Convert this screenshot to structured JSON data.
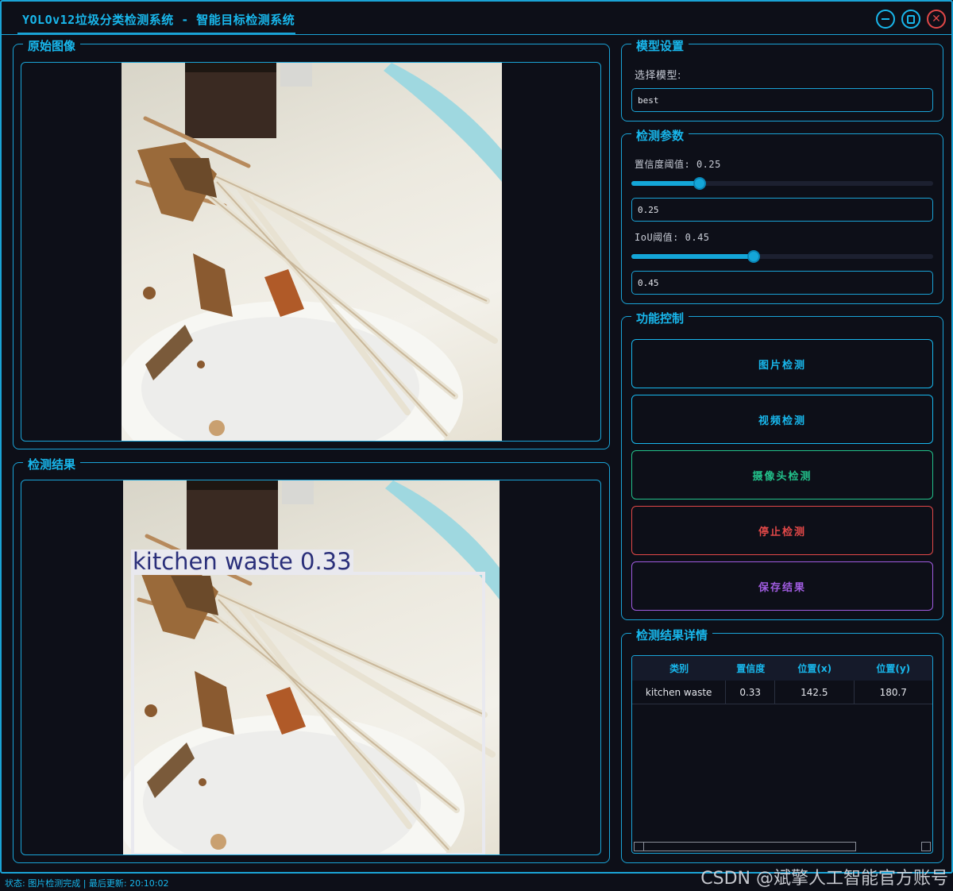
{
  "window": {
    "title": "YOLOv12垃圾分类检测系统 - 智能目标检测系统",
    "controls": [
      "minimize-icon",
      "maximize-icon",
      "close-icon"
    ]
  },
  "original_panel": {
    "title": "原始图像"
  },
  "result_panel": {
    "title": "检测结果",
    "detection_label": "kitchen waste 0.33"
  },
  "model_settings": {
    "title": "模型设置",
    "select_label": "选择模型:",
    "selected_model": "best"
  },
  "detection_params": {
    "title": "检测参数",
    "confidence_label": "置信度阈值: 0.25",
    "confidence_value": "0.25",
    "confidence_fraction": 0.25,
    "iou_label": "IoU阈值: 0.45",
    "iou_value": "0.45",
    "iou_fraction": 0.45
  },
  "function_control": {
    "title": "功能控制",
    "buttons": [
      {
        "label": "图片检测",
        "color": "#18b7ec"
      },
      {
        "label": "视频检测",
        "color": "#18b7ec"
      },
      {
        "label": "摄像头检测",
        "color": "#22c08a"
      },
      {
        "label": "停止检测",
        "color": "#e24848"
      },
      {
        "label": "保存结果",
        "color": "#a05ce0"
      }
    ]
  },
  "results_detail": {
    "title": "检测结果详情",
    "columns": [
      "类别",
      "置信度",
      "位置(x)",
      "位置(y)"
    ],
    "rows": [
      [
        "kitchen waste",
        "0.33",
        "142.5",
        "180.7"
      ]
    ]
  },
  "statusbar": {
    "text": "状态: 图片检测完成 | 最后更新: 20:10:02"
  },
  "watermark": "CSDN @斌擎人工智能官方账号",
  "colors": {
    "accent": "#18b7ec",
    "background": "#0d0f18"
  }
}
